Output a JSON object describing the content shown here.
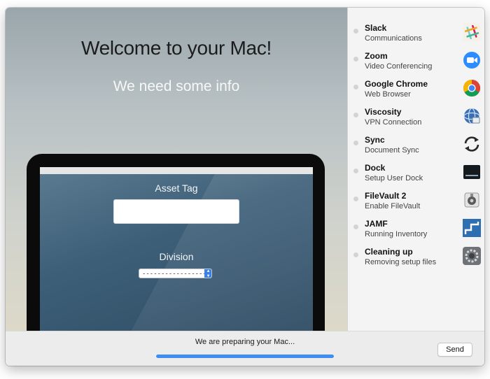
{
  "welcome": {
    "title": "Welcome to your Mac!",
    "subtitle": "We need some info"
  },
  "form": {
    "asset_tag_label": "Asset Tag",
    "asset_tag_value": "",
    "division_label": "Division",
    "division_selected": "--------------------"
  },
  "footer": {
    "status": "We are preparing your Mac...",
    "progress": 1.0,
    "send_label": "Send",
    "accent_color": "#3d8df3"
  },
  "sidebar": {
    "items": [
      {
        "name": "Slack",
        "description": "Communications",
        "icon": "slack-icon"
      },
      {
        "name": "Zoom",
        "description": "Video Conferencing",
        "icon": "zoom-icon"
      },
      {
        "name": "Google Chrome",
        "description": "Web Browser",
        "icon": "chrome-icon"
      },
      {
        "name": "Viscosity",
        "description": "VPN Connection",
        "icon": "viscosity-icon"
      },
      {
        "name": "Sync",
        "description": "Document Sync",
        "icon": "sync-icon"
      },
      {
        "name": "Dock",
        "description": "Setup User Dock",
        "icon": "dock-icon"
      },
      {
        "name": "FileVault 2",
        "description": "Enable FileVault",
        "icon": "filevault-icon"
      },
      {
        "name": "JAMF",
        "description": "Running Inventory",
        "icon": "jamf-icon"
      },
      {
        "name": "Cleaning up",
        "description": "Removing setup files",
        "icon": "cleanup-gear-icon"
      }
    ]
  }
}
